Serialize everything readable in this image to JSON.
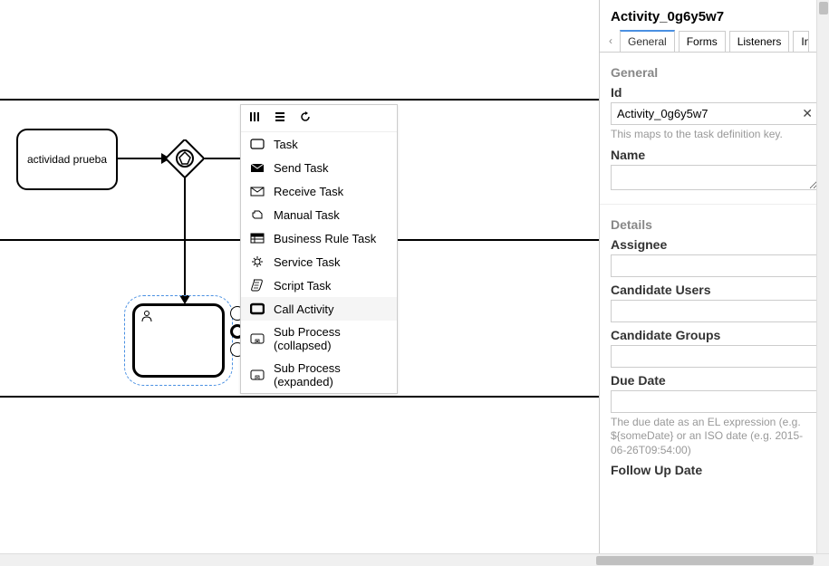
{
  "panel": {
    "title": "Activity_0g6y5w7",
    "tabs": [
      "General",
      "Forms",
      "Listeners",
      "Input/O"
    ],
    "activeTab": 0,
    "general": {
      "section_title": "General",
      "id_label": "Id",
      "id_value": "Activity_0g6y5w7",
      "id_help": "This maps to the task definition key.",
      "name_label": "Name",
      "name_value": ""
    },
    "details": {
      "section_title": "Details",
      "assignee_label": "Assignee",
      "assignee_value": "",
      "candidate_users_label": "Candidate Users",
      "candidate_users_value": "",
      "candidate_groups_label": "Candidate Groups",
      "candidate_groups_value": "",
      "due_date_label": "Due Date",
      "due_date_value": "",
      "due_date_help": "The due date as an EL expression (e.g. ${someDate} or an ISO date (e.g. 2015-06-26T09:54:00)",
      "follow_up_label": "Follow Up Date"
    }
  },
  "canvas": {
    "task1_label": "actividad prueba"
  },
  "context_menu": {
    "header_icons": [
      "parallel-icon",
      "sequential-icon",
      "loop-icon"
    ],
    "items": [
      {
        "icon": "task-icon",
        "label": "Task"
      },
      {
        "icon": "send-icon",
        "label": "Send Task"
      },
      {
        "icon": "receive-icon",
        "label": "Receive Task"
      },
      {
        "icon": "manual-icon",
        "label": "Manual Task"
      },
      {
        "icon": "business-rule-icon",
        "label": "Business Rule Task"
      },
      {
        "icon": "service-icon",
        "label": "Service Task"
      },
      {
        "icon": "script-icon",
        "label": "Script Task"
      },
      {
        "icon": "call-activity-icon",
        "label": "Call Activity"
      },
      {
        "icon": "subprocess-collapsed-icon",
        "label": "Sub Process (collapsed)"
      },
      {
        "icon": "subprocess-expanded-icon",
        "label": "Sub Process (expanded)"
      }
    ],
    "highlighted_index": 7
  }
}
